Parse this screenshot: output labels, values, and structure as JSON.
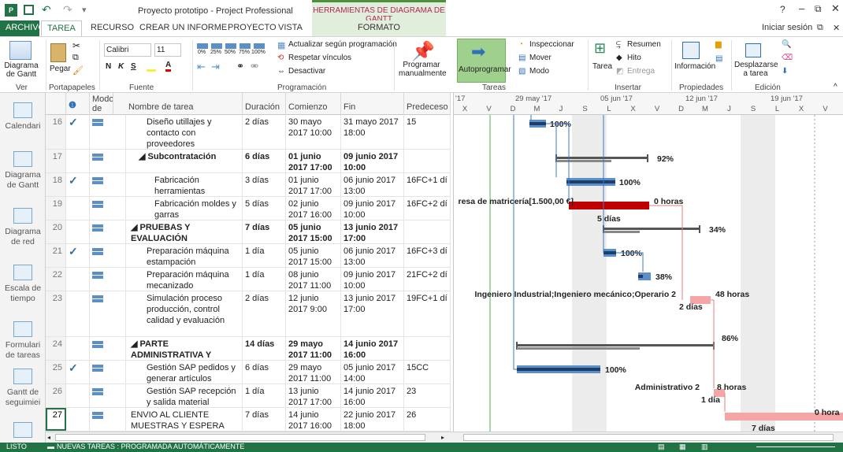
{
  "window": {
    "title": "Proyecto prototipo - Project Professional",
    "context_header": "HERRAMIENTAS DE DIAGRAMA DE GANTT",
    "help": "?",
    "signin": "Iniciar sesión"
  },
  "tabs": [
    "ARCHIVO",
    "TAREA",
    "RECURSO",
    "CREAR UN INFORME",
    "PROYECTO",
    "VISTA",
    "FORMATO"
  ],
  "ribbon": {
    "ver": {
      "button": "Diagrama de Gantt",
      "dropdown": "▾",
      "label": "Ver"
    },
    "portapapeles": {
      "paste": "Pegar",
      "label": "Portapapeles"
    },
    "fuente": {
      "font": "Calibri",
      "size": "11",
      "bold": "N",
      "italic": "K",
      "underline": "S",
      "label": "Fuente"
    },
    "programacion": {
      "update": "Actualizar según programación",
      "respect": "Respetar vínculos",
      "deactivate": "Desactivar",
      "label": "Programación"
    },
    "tareas": {
      "manual": "Programar manualmente",
      "auto": "Autoprogramar",
      "inspect": "Inspeccionar",
      "move": "Mover",
      "mode": "Modo",
      "label": "Tareas"
    },
    "insertar": {
      "task": "Tarea",
      "summary": "Resumen",
      "milestone": "Hito",
      "deliverable": "Entrega",
      "label": "Insertar"
    },
    "propiedades": {
      "info": "Información",
      "label": "Propiedades"
    },
    "edicion": {
      "scroll": "Desplazarse a tarea",
      "label": "Edición"
    },
    "pct": [
      "0%",
      "25%",
      "50%",
      "75%",
      "100%"
    ]
  },
  "viewbar": [
    "Calendari",
    "Diagrama de Gantt",
    "Diagrama de red",
    "Escala de tiempo",
    "Formulari de tareas",
    "Gantt de seguimiei"
  ],
  "grid": {
    "headers": {
      "info": "❶",
      "mode": "Modo de",
      "name": "Nombre de tarea",
      "duration": "Duración",
      "start": "Comienzo",
      "finish": "Fin",
      "pred": "Predeceso"
    },
    "rows": [
      {
        "id": "16",
        "check": "✓",
        "name": "Diseño utillajes y contacto con proveedores",
        "dur": "2 días",
        "start": "30 mayo 2017 10:00",
        "finish": "31 mayo 2017 18:00",
        "pred": "15",
        "bold": false,
        "indent": 2,
        "h": 44
      },
      {
        "id": "17",
        "check": "",
        "name": "◢ Subcontratación",
        "dur": "6 días",
        "start": "01 junio 2017 17:00",
        "finish": "09 junio 2017 10:00",
        "pred": "",
        "bold": true,
        "indent": 1,
        "h": 30
      },
      {
        "id": "18",
        "check": "✓",
        "name": "Fabricación herramientas",
        "dur": "3 días",
        "start": "01 junio 2017 17:00",
        "finish": "06 junio 2017 13:00",
        "pred": "16FC+1 dí",
        "bold": false,
        "indent": 3,
        "h": 30
      },
      {
        "id": "19",
        "check": "",
        "name": "Fabricación moldes y garras",
        "dur": "5 días",
        "start": "02 junio 2017 16:00",
        "finish": "09 junio 2017 10:00",
        "pred": "16FC+2 dí",
        "bold": false,
        "indent": 3,
        "h": 30
      },
      {
        "id": "20",
        "check": "",
        "name": "◢ PRUEBAS Y EVALUACIÓN",
        "dur": "7 días",
        "start": "05 junio 2017 15:00",
        "finish": "13 junio 2017 17:00",
        "pred": "",
        "bold": true,
        "indent": 0,
        "h": 30
      },
      {
        "id": "21",
        "check": "✓",
        "name": "Preparación máquina estampación",
        "dur": "1 día",
        "start": "05 junio 2017 15:00",
        "finish": "06 junio 2017 13:00",
        "pred": "16FC+3 dí",
        "bold": false,
        "indent": 2,
        "h": 30
      },
      {
        "id": "22",
        "check": "",
        "name": "Preparación máquina mecanizado",
        "dur": "1 día",
        "start": "08 junio 2017 11:00",
        "finish": "09 junio 2017 10:00",
        "pred": "21FC+2 dí",
        "bold": false,
        "indent": 2,
        "h": 30
      },
      {
        "id": "23",
        "check": "",
        "name": "Simulación proceso producción, control calidad y evaluación",
        "dur": "2 días",
        "start": "12 junio 2017 9:00",
        "finish": "13 junio 2017 17:00",
        "pred": "19FC+1 dí",
        "bold": false,
        "indent": 2,
        "h": 58
      },
      {
        "id": "24",
        "check": "",
        "name": "◢ PARTE ADMINISTRATIVA Y CIERRE PROTOTIPO",
        "dur": "14 días",
        "start": "29 mayo 2017 11:00",
        "finish": "14 junio 2017 16:00",
        "pred": "",
        "bold": true,
        "indent": 0,
        "h": 30
      },
      {
        "id": "25",
        "check": "✓",
        "name": "Gestión SAP pedidos y generar artículos",
        "dur": "6 días",
        "start": "29 mayo 2017 11:00",
        "finish": "05 junio 2017 14:00",
        "pred": "15CC",
        "bold": false,
        "indent": 2,
        "h": 30
      },
      {
        "id": "26",
        "check": "",
        "name": "Gestión SAP recepción y salida material",
        "dur": "1 día",
        "start": "13 junio 2017 17:00",
        "finish": "14 junio 2017 16:00",
        "pred": "23",
        "bold": false,
        "indent": 2,
        "h": 30
      },
      {
        "id": "27",
        "check": "",
        "name": "ENVIO AL CLIENTE MUESTRAS Y ESPERA",
        "dur": "7 días",
        "start": "14 junio 2017 16:00",
        "finish": "22 junio 2017 18:00",
        "pred": "26",
        "bold": false,
        "indent": 0,
        "h": 30
      }
    ]
  },
  "timescale": {
    "weeks": [
      "'17",
      "29 may '17",
      "05 jun '17",
      "12 jun '17",
      "19 jun '17"
    ],
    "days": [
      "X",
      "V",
      "D",
      "M",
      "J",
      "S",
      "L",
      "X",
      "V",
      "D",
      "M",
      "J",
      "S",
      "L",
      "X",
      "V"
    ]
  },
  "bar_labels": {
    "r16": "100%",
    "r17": "92%",
    "r18": "100%",
    "r19_left": "resa de matricería[1.500,00 €]",
    "r19_right": "0 horas",
    "r19_dur": "5 días",
    "r20": "34%",
    "r21": "100%",
    "r22": "38%",
    "r23_left": "Ingeniero Industrial;Ingeniero mecánico;Operario 2",
    "r23_right": "48 horas",
    "r23_dur": "2 días",
    "r24": "86%",
    "r25": "100%",
    "r26_left": "Administrativo 2",
    "r26_right": "8 horas",
    "r26_dur": "1 día",
    "r27_right": "0 hora",
    "r27_dur": "7 días"
  },
  "status": {
    "ready": "LISTO",
    "new_tasks": "NUEVAS TAREAS : PROGRAMADA AUTOMÁTICAMENTE"
  }
}
